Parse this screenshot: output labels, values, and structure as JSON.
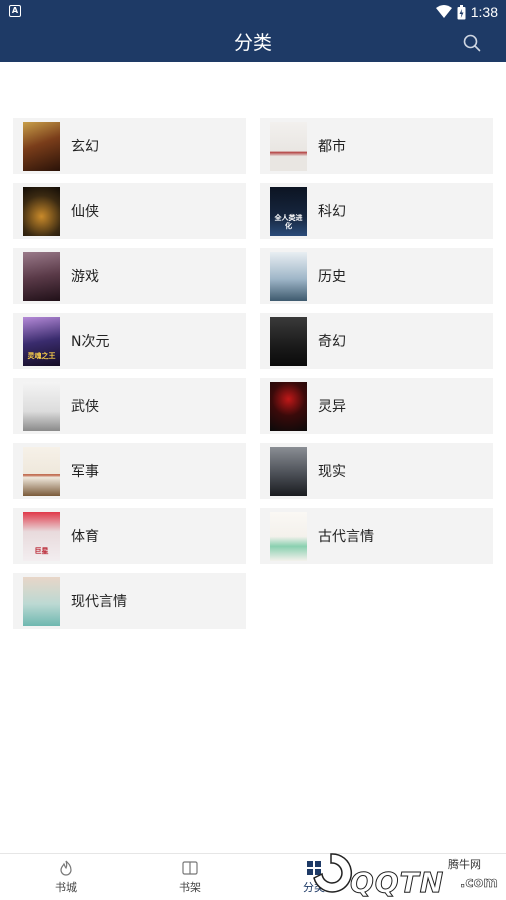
{
  "status_bar": {
    "time": "1:38"
  },
  "header": {
    "title": "分类"
  },
  "categories": [
    {
      "label": "玄幻",
      "cover_text": ""
    },
    {
      "label": "都市",
      "cover_text": ""
    },
    {
      "label": "仙侠",
      "cover_text": ""
    },
    {
      "label": "科幻",
      "cover_text": "全人类进化"
    },
    {
      "label": "游戏",
      "cover_text": ""
    },
    {
      "label": "历史",
      "cover_text": ""
    },
    {
      "label": "N次元",
      "cover_text": "灵魂之王"
    },
    {
      "label": "奇幻",
      "cover_text": ""
    },
    {
      "label": "武侠",
      "cover_text": ""
    },
    {
      "label": "灵异",
      "cover_text": ""
    },
    {
      "label": "军事",
      "cover_text": ""
    },
    {
      "label": "现实",
      "cover_text": ""
    },
    {
      "label": "体育",
      "cover_text": "巨星"
    },
    {
      "label": "古代言情",
      "cover_text": ""
    },
    {
      "label": "现代言情",
      "cover_text": ""
    }
  ],
  "cover_colors": [
    "#7a3d1a",
    "#e9e6e2",
    "#3b2a12",
    "#16263f",
    "#5a3a48",
    "#9fb6c8",
    "#3a2c6e",
    "#1a1a1a",
    "#dcdcdc",
    "#3a0a0a",
    "#efe8dc",
    "#4b4f56",
    "#e8dadc",
    "#f4f1ec",
    "#bcd9d3"
  ],
  "tabbar": {
    "tabs": [
      {
        "label": "书城"
      },
      {
        "label": "书架"
      },
      {
        "label": "分类"
      }
    ]
  },
  "watermark": {
    "brand": "QQTN",
    "domain": ".com",
    "caption": "腾牛网"
  }
}
